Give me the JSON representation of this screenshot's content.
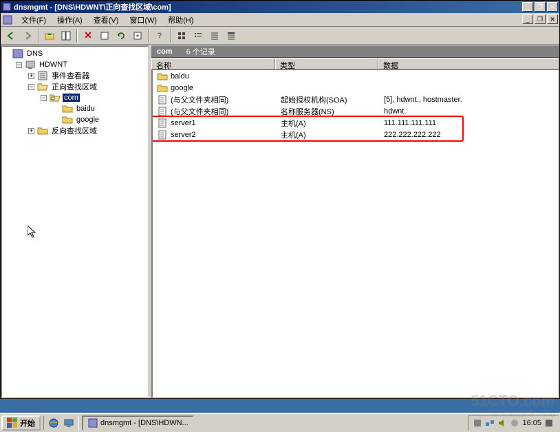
{
  "window": {
    "title": "dnsmgmt - [DNS\\HDWNT\\正向查找区域\\com]"
  },
  "menu": {
    "file": "文件(F)",
    "action": "操作(A)",
    "view": "查看(V)",
    "window": "窗口(W)",
    "help": "帮助(H)"
  },
  "tree": {
    "root": "DNS",
    "server": "HDWNT",
    "eventviewer": "事件查看器",
    "forward": "正向查找区域",
    "com": "com",
    "baidu": "baidu",
    "google": "google",
    "reverse": "反向查找区域"
  },
  "pathbar": {
    "name": "com",
    "records": "6 个记录"
  },
  "columns": {
    "name": "名称",
    "type": "类型",
    "data": "数据"
  },
  "rows": [
    {
      "icon": "folder",
      "name": "baidu",
      "type": "",
      "data": ""
    },
    {
      "icon": "folder",
      "name": "google",
      "type": "",
      "data": ""
    },
    {
      "icon": "doc",
      "name": "(与父文件夹相同)",
      "type": "起始授权机构(SOA)",
      "data": "[5], hdwnt., hostmaster."
    },
    {
      "icon": "doc",
      "name": "(与父文件夹相同)",
      "type": "名称服务器(NS)",
      "data": "hdwnt."
    },
    {
      "icon": "doc",
      "name": "server1",
      "type": "主机(A)",
      "data": "111.111.111.111"
    },
    {
      "icon": "doc",
      "name": "server2",
      "type": "主机(A)",
      "data": "222.222.222.222"
    }
  ],
  "taskbar": {
    "start": "开始",
    "task1": "dnsmgmt - [DNS\\HDWN...",
    "clock": "16:05"
  },
  "watermark": "51CTO.com",
  "watermark2": "技术成就梦想 · Blog"
}
